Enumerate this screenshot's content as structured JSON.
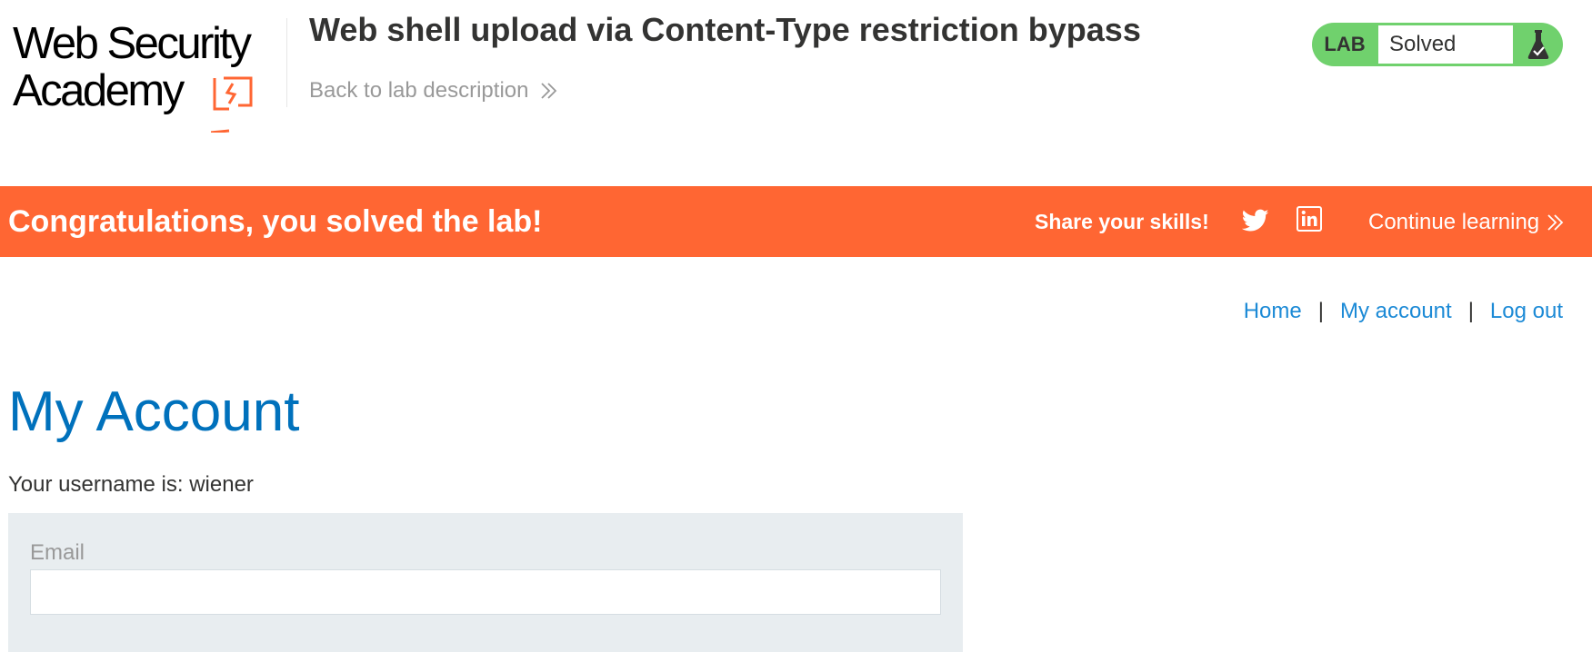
{
  "header": {
    "logo": {
      "line1": "Web Security",
      "line2": "Academy"
    },
    "lab_title": "Web shell upload via Content-Type restriction bypass",
    "back_link": "Back to lab description",
    "lab_status": {
      "label": "LAB",
      "state": "Solved",
      "icon": "flask-check-icon"
    }
  },
  "banner": {
    "message": "Congratulations, you solved the lab!",
    "share_label": "Share your skills!",
    "icons": [
      "twitter-icon",
      "linkedin-icon"
    ],
    "continue_label": "Continue learning",
    "background_color": "#ff6633"
  },
  "nav": {
    "links": [
      "Home",
      "My account",
      "Log out"
    ],
    "separator": "|"
  },
  "main": {
    "title": "My Account",
    "username_text": "Your username is: wiener",
    "email_form": {
      "label": "Email",
      "value": ""
    }
  },
  "colors": {
    "accent_blue": "#0071bc",
    "link_blue": "#1c8ad6",
    "solved_green": "#70d16d",
    "banner_orange": "#ff6633"
  }
}
